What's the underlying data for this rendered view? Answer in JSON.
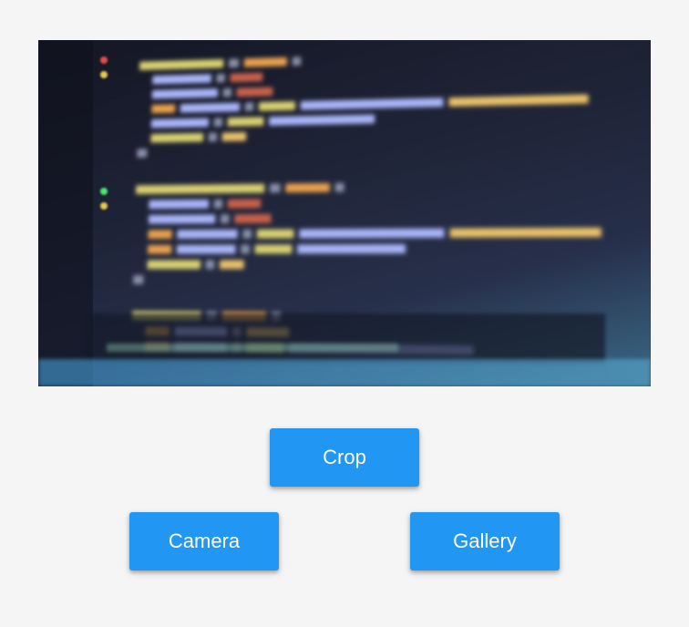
{
  "buttons": {
    "crop_label": "Crop",
    "camera_label": "Camera",
    "gallery_label": "Gallery"
  }
}
